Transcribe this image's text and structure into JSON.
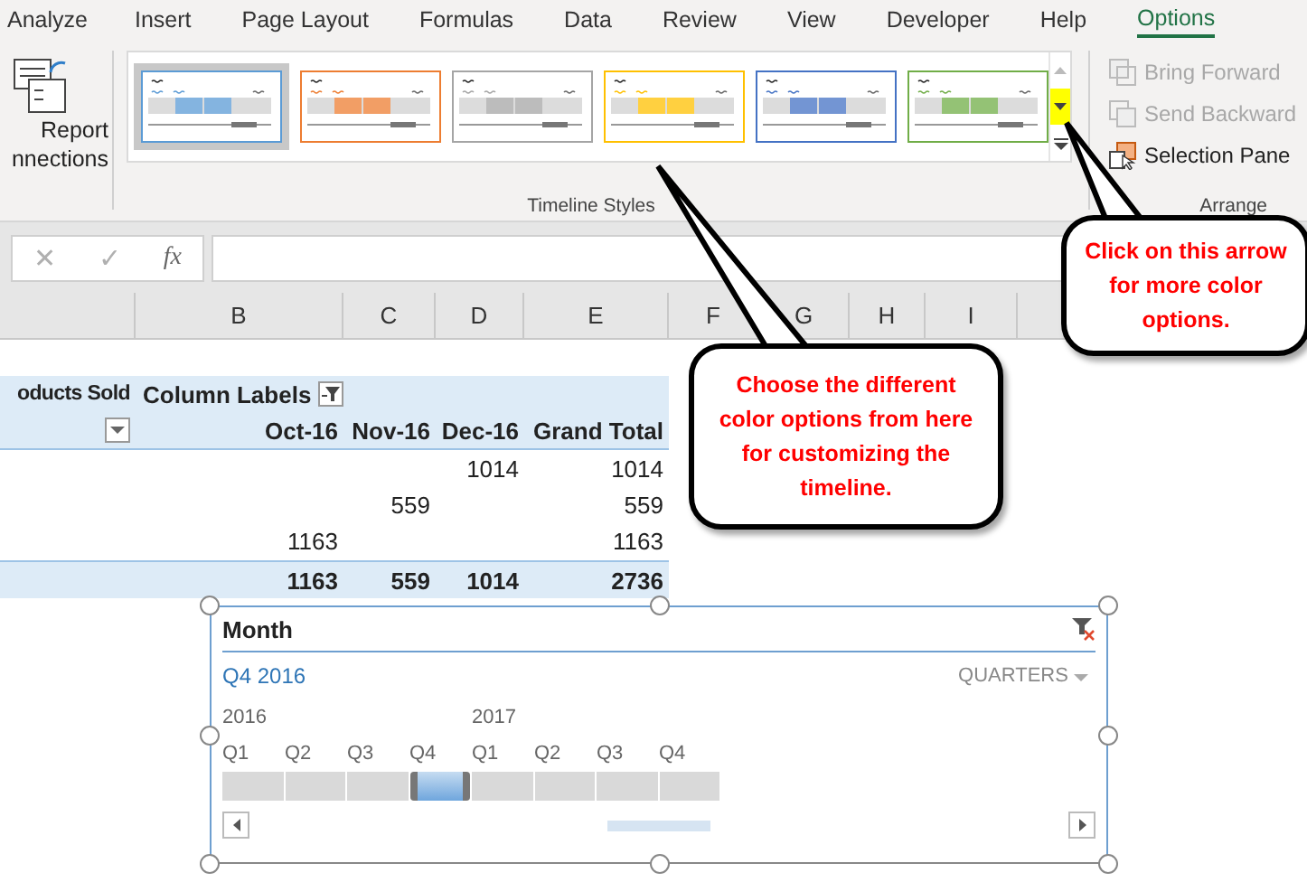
{
  "ribbon_tabs": [
    {
      "label": "Analyze",
      "selected": false
    },
    {
      "label": "Insert",
      "selected": false
    },
    {
      "label": "Page Layout",
      "selected": false
    },
    {
      "label": "Formulas",
      "selected": false
    },
    {
      "label": "Data",
      "selected": false
    },
    {
      "label": "Review",
      "selected": false
    },
    {
      "label": "View",
      "selected": false
    },
    {
      "label": "Developer",
      "selected": false
    },
    {
      "label": "Help",
      "selected": false
    },
    {
      "label": "Options",
      "selected": true
    }
  ],
  "report_connections": {
    "lines": [
      "Report",
      "nnections"
    ]
  },
  "timeline_styles": {
    "label": "Timeline Styles",
    "more_highlighted": true,
    "styles": [
      {
        "color": "#5b9bd5",
        "selected": true
      },
      {
        "color": "#ed7d31",
        "selected": false
      },
      {
        "color": "#a5a5a5",
        "selected": false
      },
      {
        "color": "#ffc000",
        "selected": false
      },
      {
        "color": "#4472c4",
        "selected": false
      },
      {
        "color": "#70ad47",
        "selected": false
      }
    ]
  },
  "arrange": {
    "label": "Arrange",
    "items": [
      {
        "label": "Bring Forward",
        "disabled": true,
        "kind": "forward"
      },
      {
        "label": "Send Backward",
        "disabled": true,
        "kind": "backward"
      },
      {
        "label": "Selection Pane",
        "disabled": false,
        "kind": "pane"
      }
    ]
  },
  "formula_bar": {
    "cancel": "✕",
    "enter": "✓",
    "function": "fx"
  },
  "columns": [
    "B",
    "C",
    "D",
    "E",
    "F",
    "G",
    "H",
    "I"
  ],
  "pivot": {
    "row_header": "oducts Sold",
    "column_header": "Column Labels",
    "months": [
      "Oct-16",
      "Nov-16",
      "Dec-16",
      "Grand Total"
    ],
    "rows": [
      {
        "kind": "data",
        "cells": [
          null,
          null,
          "1014",
          "1014"
        ]
      },
      {
        "kind": "data",
        "cells": [
          null,
          "559",
          null,
          "559"
        ]
      },
      {
        "kind": "data",
        "cells": [
          "1163",
          null,
          null,
          "1163"
        ]
      },
      {
        "kind": "total",
        "cells": [
          "1163",
          "559",
          "1014",
          "2736"
        ]
      }
    ]
  },
  "timeline": {
    "title": "Month",
    "selection": "Q4 2016",
    "level": "QUARTERS",
    "years": [
      "2016",
      "2017"
    ],
    "periods": [
      {
        "label": "Q1",
        "selected": false
      },
      {
        "label": "Q2",
        "selected": false
      },
      {
        "label": "Q3",
        "selected": false
      },
      {
        "label": "Q4",
        "selected": true
      },
      {
        "label": "Q1",
        "selected": false
      },
      {
        "label": "Q2",
        "selected": false
      },
      {
        "label": "Q3",
        "selected": false
      },
      {
        "label": "Q4",
        "selected": false
      }
    ]
  },
  "callouts": [
    {
      "text": "Choose the different color options from here for customizing the timeline.",
      "kind": "styles"
    },
    {
      "text": "Click on this arrow for more color options.",
      "kind": "arrow"
    }
  ]
}
